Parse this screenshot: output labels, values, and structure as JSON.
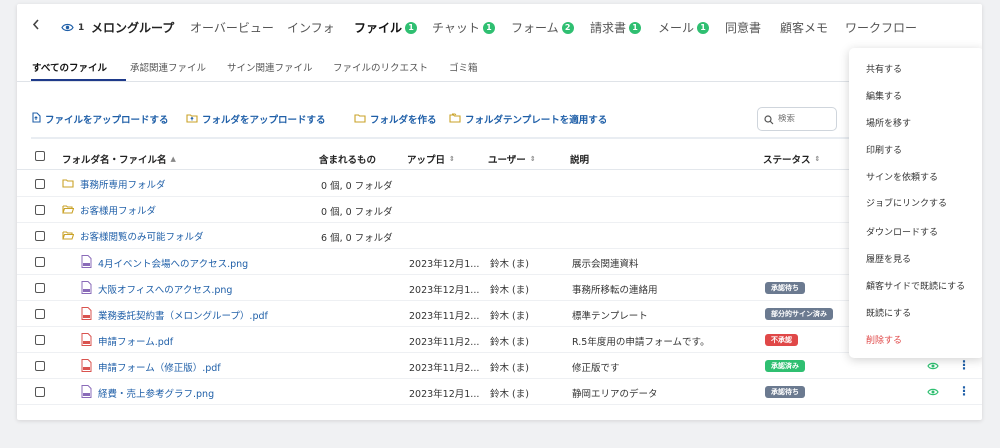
{
  "nav": {
    "back_icon": "chevron-left-icon",
    "viewer_count": "1",
    "group_name": "メロングループ",
    "tabs": [
      {
        "label": "オーバービュー",
        "badge": ""
      },
      {
        "label": "インフォ",
        "badge": ""
      },
      {
        "label": "ファイル",
        "badge": "1"
      },
      {
        "label": "チャット",
        "badge": "1"
      },
      {
        "label": "フォーム",
        "badge": "2"
      },
      {
        "label": "請求書",
        "badge": "1"
      },
      {
        "label": "メール",
        "badge": "1"
      },
      {
        "label": "同意書",
        "badge": ""
      },
      {
        "label": "顧客メモ",
        "badge": ""
      },
      {
        "label": "ワークフロー",
        "badge": ""
      }
    ]
  },
  "subtabs": [
    "すべてのファイル",
    "承認関連ファイル",
    "サイン関連ファイル",
    "ファイルのリクエスト",
    "ゴミ箱"
  ],
  "actions": {
    "upload_file": "ファイルをアップロードする",
    "upload_folder": "フォルダをアップロードする",
    "create_folder": "フォルダを作る",
    "apply_template": "フォルダテンプレートを適用する"
  },
  "search": {
    "placeholder": "検索"
  },
  "table": {
    "headers": {
      "name": "フォルダ名・ファイル名",
      "contains": "含まれるもの",
      "uploaded": "アップ日",
      "user": "ユーザー",
      "description": "説明",
      "status": "ステータス"
    },
    "rows": [
      {
        "type": "folder",
        "name": "事務所専用フォルダ",
        "contains": "0 個, 0 フォルダ",
        "date": "",
        "user": "",
        "desc": "",
        "status": ""
      },
      {
        "type": "folder",
        "name": "お客様用フォルダ",
        "contains": "0 個, 0 フォルダ",
        "date": "",
        "user": "",
        "desc": "",
        "status": ""
      },
      {
        "type": "folder",
        "name": "お客様閲覧のみ可能フォルダ",
        "contains": "6 個, 0 フォルダ",
        "date": "",
        "user": "",
        "desc": "",
        "status": ""
      },
      {
        "type": "img",
        "name": "4月イベント会場へのアクセス.png",
        "contains": "",
        "date": "2023年12月1...",
        "user": "鈴木 (ま)",
        "desc": "展示会関連資料",
        "status": ""
      },
      {
        "type": "img",
        "name": "大阪オフィスへのアクセス.png",
        "contains": "",
        "date": "2023年12月1...",
        "user": "鈴木 (ま)",
        "desc": "事務所移転の連絡用",
        "status": "承認待ち"
      },
      {
        "type": "pdf",
        "name": "業務委託契約書（メロングループ）.pdf",
        "contains": "",
        "date": "2023年11月2...",
        "user": "鈴木 (ま)",
        "desc": "標準テンプレート",
        "status": "部分的サイン済み"
      },
      {
        "type": "pdf",
        "name": "申請フォーム.pdf",
        "contains": "",
        "date": "2023年11月2...",
        "user": "鈴木 (ま)",
        "desc": "R.5年度用の申請フォームです。",
        "status": "不承認"
      },
      {
        "type": "pdf",
        "name": "申請フォーム（修正版）.pdf",
        "contains": "",
        "date": "2023年11月2...",
        "user": "鈴木 (ま)",
        "desc": "修正版です",
        "status": "承認済み"
      },
      {
        "type": "img",
        "name": "経費・売上参考グラフ.png",
        "contains": "",
        "date": "2023年12月1...",
        "user": "鈴木 (ま)",
        "desc": "静岡エリアのデータ",
        "status": "承認待ち"
      }
    ]
  },
  "menu": [
    "共有する",
    "編集する",
    "場所を移す",
    "印刷する",
    "サインを依頼する",
    "ジョブにリンクする",
    "ダウンロードする",
    "履歴を見る",
    "顧客サイドで既読にする",
    "既読にする",
    "削除する"
  ],
  "colors": {
    "accent": "#1f5fa8",
    "badge": "#2fbf71",
    "status_pending": "#6b7a90",
    "status_partial": "#6b7a90",
    "status_rejected": "#e04848",
    "status_approved": "#2fbf71",
    "delete": "#e04848"
  }
}
